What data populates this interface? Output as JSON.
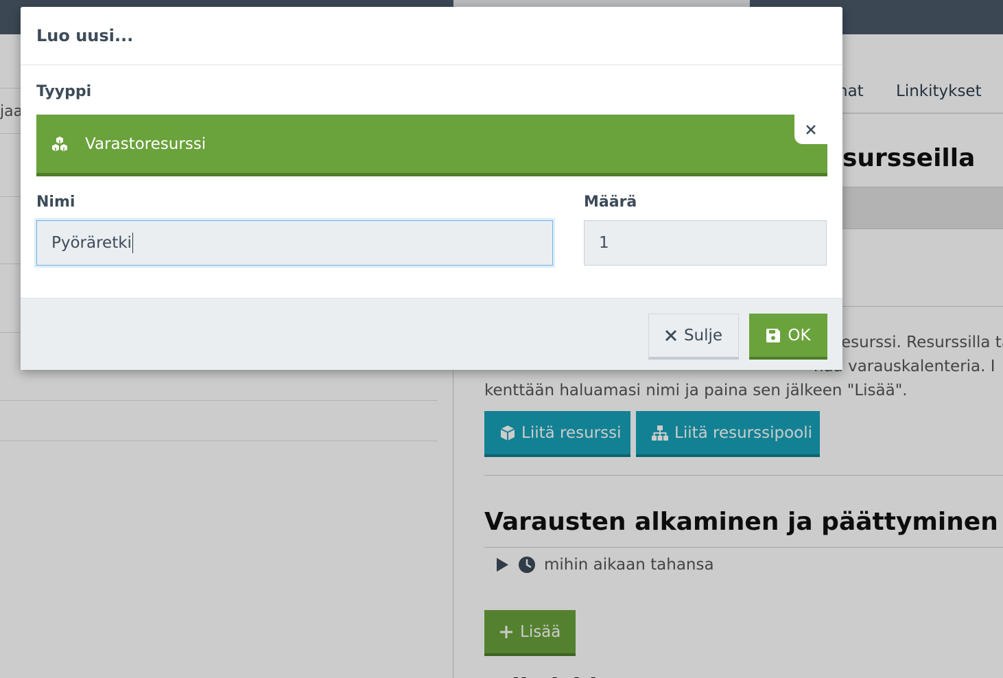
{
  "background": {
    "left_pane": {
      "truncated_text": "jaa"
    },
    "tabs": [
      {
        "label": "hat"
      },
      {
        "label": "Linkitykset"
      }
    ],
    "section_resources_title": "sursseilla",
    "description": {
      "line1": "esurssi. Resurssilla ta",
      "line2": "naa varauskalenteria. I",
      "line3": "kenttään haluamasi nimi ja paina sen jälkeen \"Lisää\"."
    },
    "buttons": {
      "attach_resource": "Liitä resurssi",
      "attach_resource_pool": "Liitä resurssipooli",
      "add": "Lisää"
    },
    "section_timing_title": "Varausten alkaminen ja päättyminen",
    "timing_item": "mihin aikaan tahansa",
    "cut_title": "Erikoishinnat"
  },
  "modal": {
    "title": "Luo uusi...",
    "type_label": "Tyyppi",
    "type_value": "Varastoresurssi",
    "type_icon": "cubes-icon",
    "name_label": "Nimi",
    "name_value": "Pyöräretki",
    "quantity_label": "Määrä",
    "quantity_value": "1",
    "close_label": "Sulje",
    "ok_label": "OK"
  },
  "colors": {
    "green": "#6aa23b",
    "teal": "#17a2b8",
    "dark": "#4a5a6a"
  }
}
